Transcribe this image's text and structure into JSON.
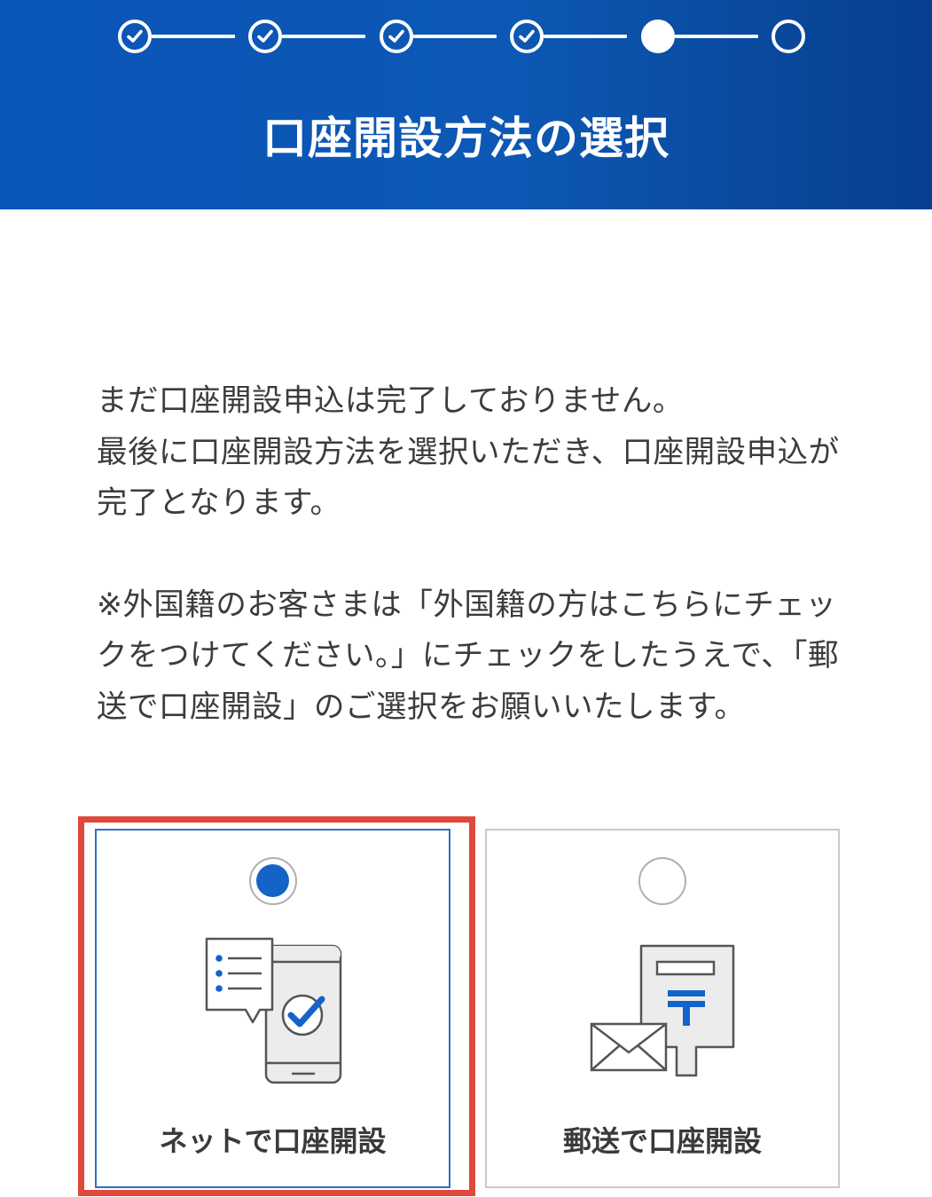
{
  "header": {
    "title": "口座開設方法の選択",
    "steps": [
      {
        "name": "step-1",
        "state": "completed"
      },
      {
        "name": "step-2",
        "state": "completed"
      },
      {
        "name": "step-3",
        "state": "completed"
      },
      {
        "name": "step-4",
        "state": "completed"
      },
      {
        "name": "step-5",
        "state": "current"
      },
      {
        "name": "step-6",
        "state": "upcoming"
      }
    ]
  },
  "intro": {
    "line1": "まだ口座開設申込は完了しておりません。",
    "line2": "最後に口座開設方法を選択いただき、口座開設申込が完了となります。",
    "note": "※外国籍のお客さまは「外国籍の方はこちらにチェックをつけてください。」にチェックをしたうえで、「郵送で口座開設」のご選択をお願いいたします。"
  },
  "options": [
    {
      "label": "ネットで口座開設",
      "icon": "smartphone-checklist-icon",
      "selected": true
    },
    {
      "label": "郵送で口座開設",
      "icon": "mail-postal-document-icon",
      "selected": false
    }
  ],
  "colors": {
    "header_blue": "#0a55b8",
    "accent_blue": "#1463c8",
    "highlight_red": "#e0483b",
    "text": "#333333"
  }
}
